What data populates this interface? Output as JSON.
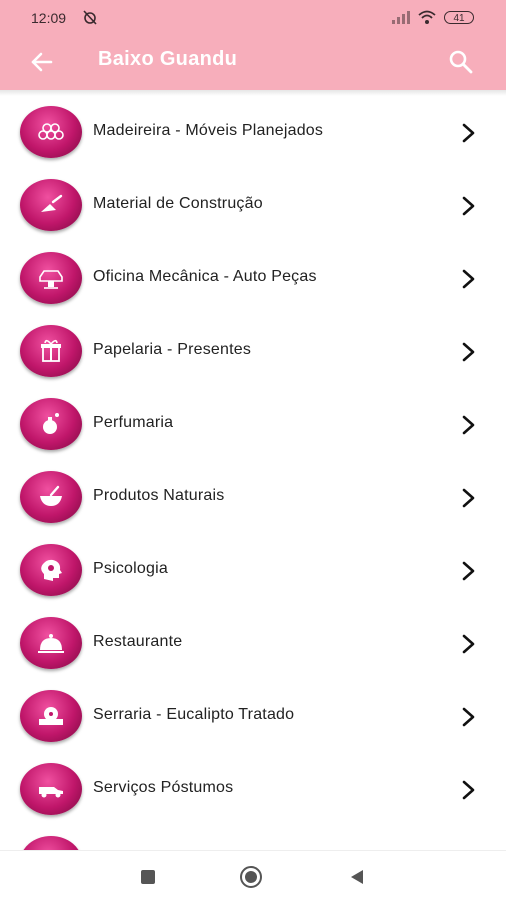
{
  "status": {
    "time": "12:09",
    "battery": "41"
  },
  "toolbar": {
    "title": "Baixo Guandu"
  },
  "colors": {
    "appbar": "#f7aebb",
    "icon_circle": "#c0166a",
    "title": "#ffffff"
  },
  "items": [
    {
      "label": "Madeireira - Móveis Planejados",
      "icon": "lumber-icon"
    },
    {
      "label": "Material de Construção",
      "icon": "trowel-icon"
    },
    {
      "label": "Oficina Mecânica - Auto Peças",
      "icon": "car-jack-icon"
    },
    {
      "label": "Papelaria - Presentes",
      "icon": "gift-icon"
    },
    {
      "label": "Perfumaria",
      "icon": "perfume-icon"
    },
    {
      "label": "Produtos Naturais",
      "icon": "mortar-pestle-icon"
    },
    {
      "label": "Psicologia",
      "icon": "head-icon"
    },
    {
      "label": "Restaurante",
      "icon": "cloche-icon"
    },
    {
      "label": "Serraria - Eucalipto Tratado",
      "icon": "saw-icon"
    },
    {
      "label": "Serviços Póstumos",
      "icon": "hearse-icon"
    }
  ]
}
